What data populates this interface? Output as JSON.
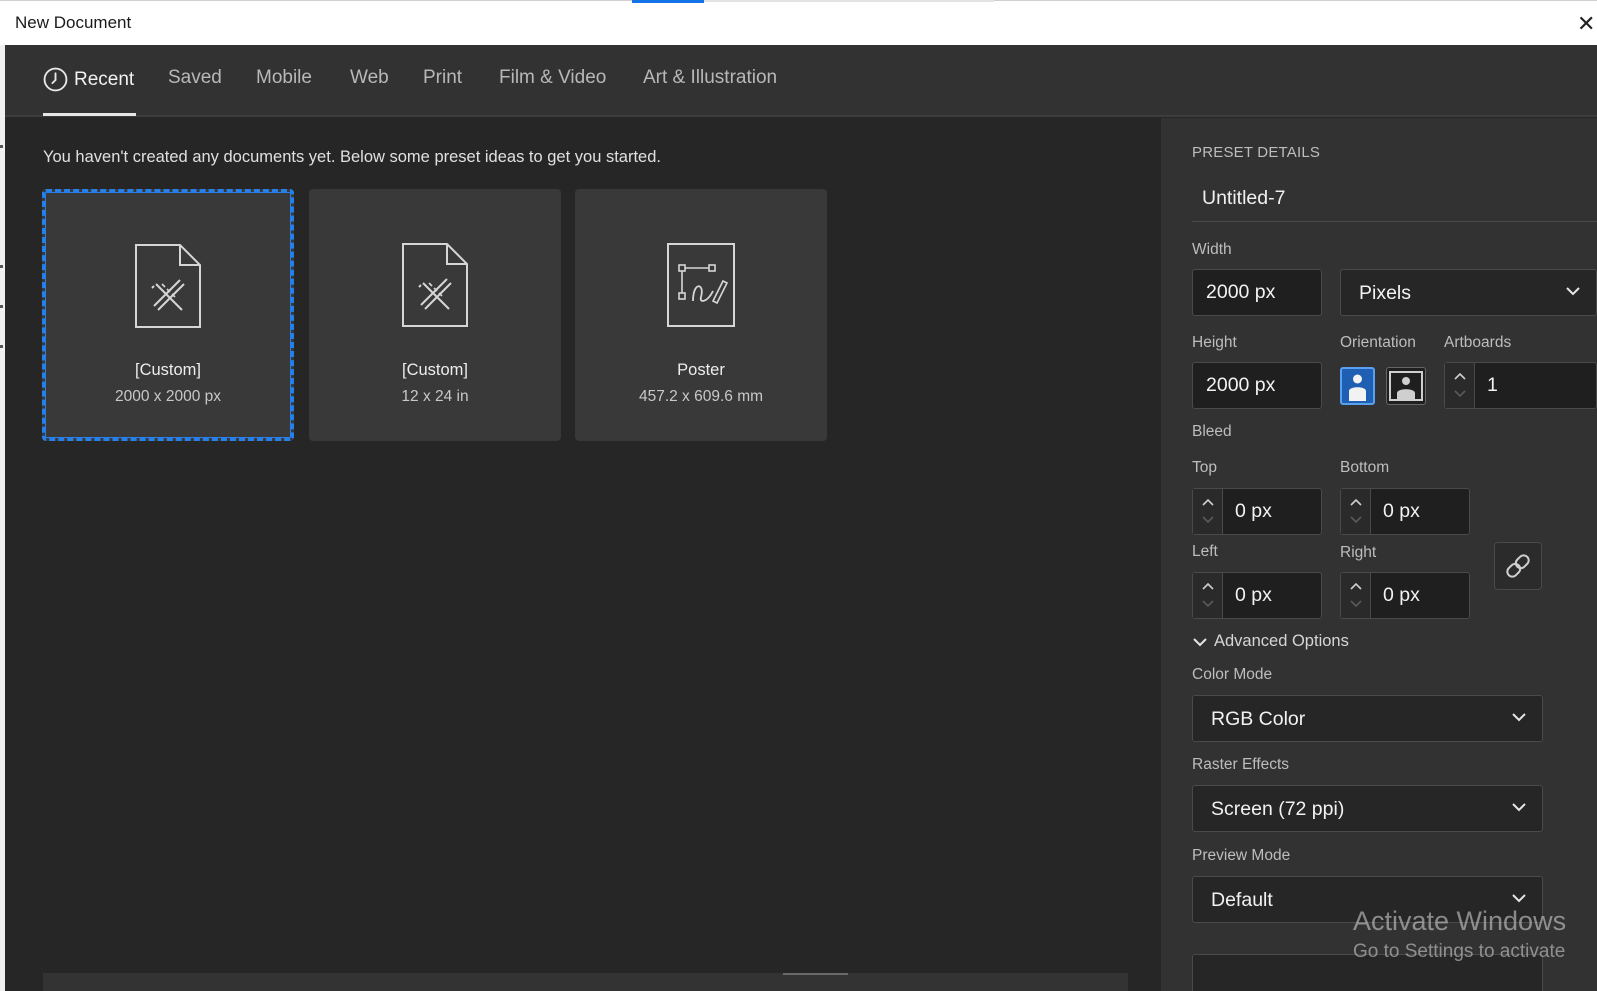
{
  "window": {
    "title": "New Document",
    "close_glyph": "✕"
  },
  "tabs": [
    {
      "label": "Recent",
      "icon": "clock-icon",
      "active": true
    },
    {
      "label": "Saved"
    },
    {
      "label": "Mobile"
    },
    {
      "label": "Web"
    },
    {
      "label": "Print"
    },
    {
      "label": "Film & Video"
    },
    {
      "label": "Art & Illustration"
    }
  ],
  "main": {
    "intro": "You haven't created any documents yet. Below some preset ideas to get you started.",
    "presets": [
      {
        "name": "[Custom]",
        "size": "2000 x 2000 px",
        "icon": "document-ruler-pencil-icon",
        "selected": true
      },
      {
        "name": "[Custom]",
        "size": "12 x 24 in",
        "icon": "document-ruler-pencil-icon"
      },
      {
        "name": "Poster",
        "size": "457.2 x 609.6 mm",
        "icon": "poster-pen-icon"
      }
    ]
  },
  "panel": {
    "header": "PRESET DETAILS",
    "doc_name": "Untitled-7",
    "width_label": "Width",
    "width_value": "2000 px",
    "units": "Pixels",
    "height_label": "Height",
    "height_value": "2000 px",
    "orientation_label": "Orientation",
    "artboards_label": "Artboards",
    "artboards_value": "1",
    "bleed_label": "Bleed",
    "top_label": "Top",
    "top_value": "0 px",
    "bottom_label": "Bottom",
    "bottom_value": "0 px",
    "left_label": "Left",
    "left_value": "0 px",
    "right_label": "Right",
    "right_value": "0 px",
    "advanced_label": "Advanced Options",
    "color_mode_label": "Color Mode",
    "color_mode_value": "RGB Color",
    "raster_label": "Raster Effects",
    "raster_value": "Screen (72 ppi)",
    "preview_label": "Preview Mode",
    "preview_value": "Default"
  },
  "watermark": {
    "line1": "Activate Windows",
    "line2": "Go to Settings to activate"
  },
  "colors": {
    "accent": "#2680eb",
    "panel": "#323232",
    "background": "#262626"
  }
}
